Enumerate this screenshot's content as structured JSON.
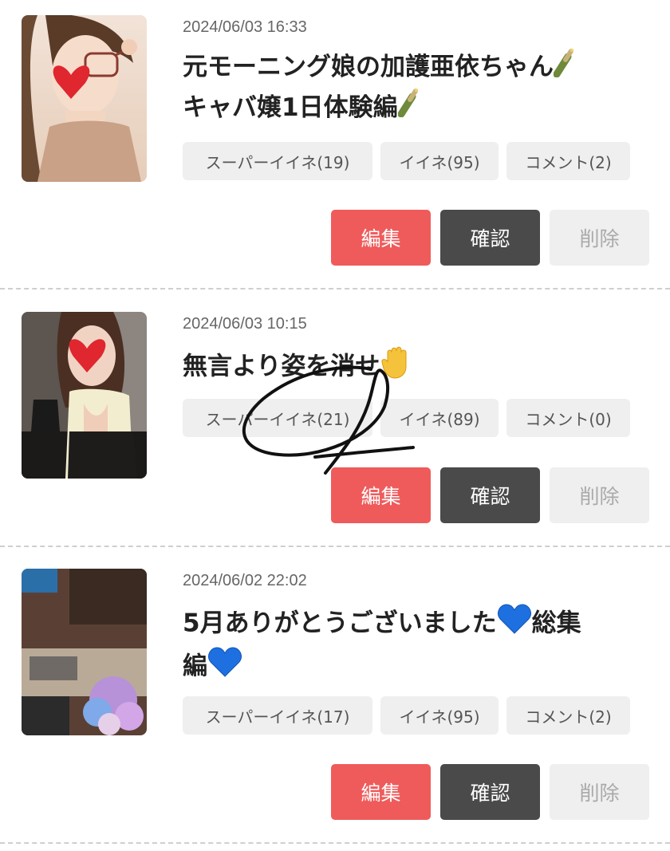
{
  "posts": [
    {
      "date": "2024/06/03 16:33",
      "title_line1": "元モーニング娘の加護亜依ちゃん",
      "title_line2": "キャバ嬢1日体験編",
      "emoji": "champagne",
      "tags": {
        "super": "スーパーイイネ(19)",
        "iine": "イイネ(95)",
        "comment": "コメント(2)"
      }
    },
    {
      "date": "2024/06/03 10:15",
      "title_line1": "無言より姿を消せ",
      "title_line2": "",
      "emoji": "raised-hand",
      "tags": {
        "super": "スーパーイイネ(21)",
        "iine": "イイネ(89)",
        "comment": "コメント(0)"
      }
    },
    {
      "date": "2024/06/02 22:02",
      "title_line1": "5月ありがとうございました",
      "title_line1_suffix": "総集",
      "title_line2": "編",
      "emoji": "blue-heart",
      "tags": {
        "super": "スーパーイイネ(17)",
        "iine": "イイネ(95)",
        "comment": "コメント(2)"
      }
    }
  ],
  "actions": {
    "edit": "編集",
    "confirm": "確認",
    "delete": "削除"
  },
  "colors": {
    "edit_button": "#ef5b5b",
    "confirm_button": "#4a4a4a",
    "delete_button": "#efefef",
    "tag_background": "#efefef"
  }
}
